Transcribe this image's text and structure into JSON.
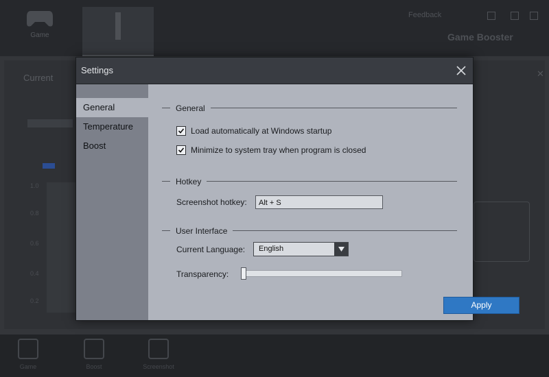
{
  "background_app": {
    "nav_game_label": "Game",
    "topright_link": "Feedback",
    "brand": "Game Booster",
    "panel_title": "Current",
    "bottom_items": [
      "Game",
      "Boost",
      "Screenshot"
    ],
    "chart_y_ticks": [
      "1.0",
      "0.8",
      "0.6",
      "0.4",
      "0.2"
    ]
  },
  "dialog": {
    "title": "Settings",
    "sidebar": {
      "items": [
        {
          "label": "General",
          "active": true
        },
        {
          "label": "Temperature",
          "active": false
        },
        {
          "label": "Boost",
          "active": false
        }
      ]
    },
    "general": {
      "section_title": "General",
      "load_on_startup_label": "Load automatically at Windows startup",
      "load_on_startup_checked": true,
      "minimize_to_tray_label": "Minimize to system tray when program is closed",
      "minimize_to_tray_checked": true
    },
    "hotkey": {
      "section_title": "Hotkey",
      "screenshot_label": "Screenshot hotkey:",
      "screenshot_value": "Alt + S"
    },
    "ui": {
      "section_title": "User Interface",
      "language_label": "Current Language:",
      "language_value": "English",
      "transparency_label": "Transparency:",
      "transparency_level": 0
    },
    "apply_label": "Apply"
  },
  "colors": {
    "accent": "#2f78c4",
    "titlebar": "#393c42",
    "sidebar": "#7c808a",
    "content": "#b0b4bd"
  }
}
